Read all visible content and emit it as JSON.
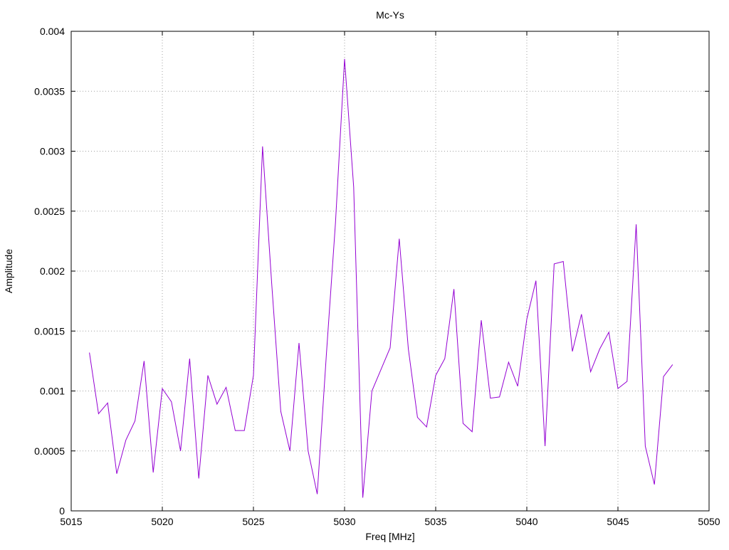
{
  "chart_data": {
    "type": "line",
    "title": "Mc-Ys",
    "xlabel": "Freq [MHz]",
    "ylabel": "Amplitude",
    "xlim": [
      5015,
      5050
    ],
    "ylim": [
      0,
      0.004
    ],
    "xticks": [
      5015,
      5020,
      5025,
      5030,
      5035,
      5040,
      5045,
      5050
    ],
    "xtick_labels": [
      "5015",
      "5020",
      "5025",
      "5030",
      "5035",
      "5040",
      "5045",
      "5050"
    ],
    "yticks": [
      0,
      0.0005,
      0.001,
      0.0015,
      0.002,
      0.0025,
      0.003,
      0.0035,
      0.004
    ],
    "ytick_labels": [
      "0",
      "0.0005",
      "0.001",
      "0.0015",
      "0.002",
      "0.0025",
      "0.003",
      "0.0035",
      "0.004"
    ],
    "grid": true,
    "series": [
      {
        "color": "#9400d3",
        "x": [
          5016,
          5016.5,
          5017,
          5017.5,
          5018,
          5018.5,
          5019,
          5019.5,
          5020,
          5020.5,
          5021,
          5021.5,
          5022,
          5022.5,
          5023,
          5023.5,
          5024,
          5024.5,
          5025,
          5025.5,
          5026,
          5026.5,
          5027,
          5027.5,
          5028,
          5028.5,
          5029,
          5029.5,
          5030,
          5030.5,
          5031,
          5031.5,
          5032,
          5032.5,
          5033,
          5033.5,
          5034,
          5034.5,
          5035,
          5035.5,
          5036,
          5036.5,
          5037,
          5037.5,
          5038,
          5038.5,
          5039,
          5039.5,
          5040,
          5040.5,
          5041,
          5041.5,
          5042,
          5042.5,
          5043,
          5043.5,
          5044,
          5044.5,
          5045,
          5045.5,
          5046,
          5046.5,
          5047,
          5047.5,
          5048
        ],
        "y": [
          0.00132,
          0.00081,
          0.0009,
          0.00031,
          0.00059,
          0.00075,
          0.00125,
          0.00032,
          0.00102,
          0.00091,
          0.0005,
          0.00127,
          0.00027,
          0.00113,
          0.00089,
          0.00103,
          0.00067,
          0.00067,
          0.00113,
          0.00304,
          0.0019,
          0.00083,
          0.0005,
          0.0014,
          0.0005,
          0.00014,
          0.0013,
          0.0024,
          0.00377,
          0.0027,
          0.00011,
          0.001,
          0.00118,
          0.00136,
          0.00227,
          0.00135,
          0.00078,
          0.0007,
          0.00113,
          0.00127,
          0.00185,
          0.00073,
          0.00066,
          0.00159,
          0.00094,
          0.00095,
          0.00124,
          0.00104,
          0.0016,
          0.00192,
          0.00054,
          0.00206,
          0.00208,
          0.00133,
          0.00164,
          0.00116,
          0.00135,
          0.00149,
          0.00102,
          0.00108,
          0.00239,
          0.00054,
          0.00022,
          0.00112,
          0.00122
        ]
      }
    ]
  }
}
